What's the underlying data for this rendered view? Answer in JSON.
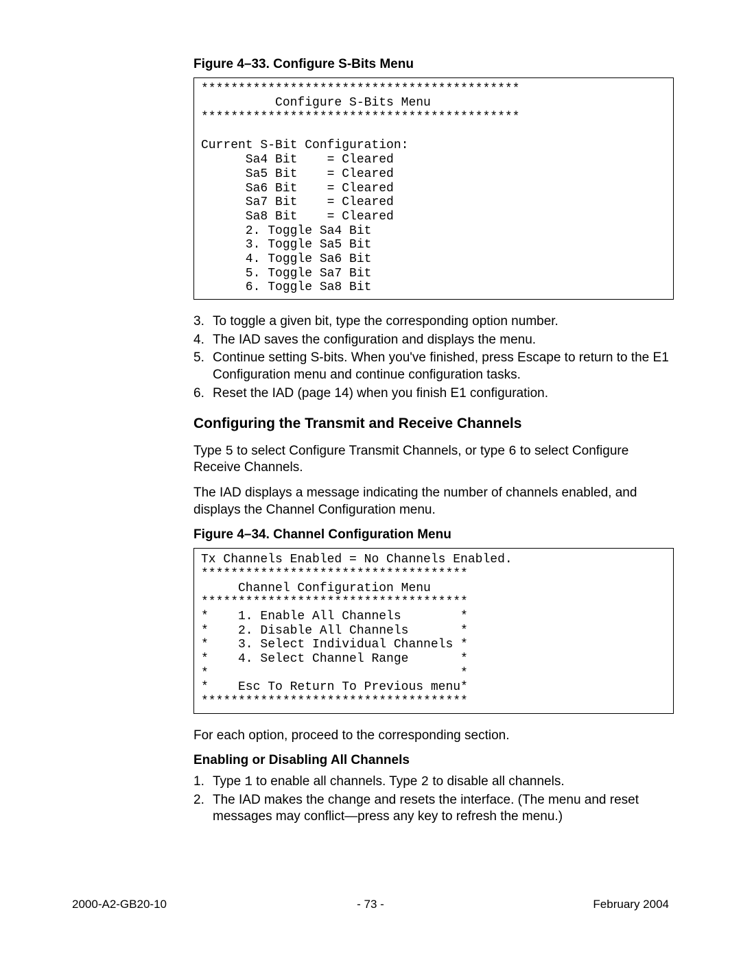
{
  "figure33": {
    "caption": "Figure 4–33.  Configure S-Bits Menu",
    "code": "*******************************************\n          Configure S-Bits Menu\n*******************************************\n\nCurrent S-Bit Configuration:\n      Sa4 Bit    = Cleared\n      Sa5 Bit    = Cleared\n      Sa6 Bit    = Cleared\n      Sa7 Bit    = Cleared\n      Sa8 Bit    = Cleared\n      2. Toggle Sa4 Bit\n      3. Toggle Sa5 Bit\n      4. Toggle Sa6 Bit\n      5. Toggle Sa7 Bit\n      6. Toggle Sa8 Bit"
  },
  "steps_a": [
    {
      "n": "3.",
      "t": "To toggle a given bit, type the corresponding option number."
    },
    {
      "n": "4.",
      "t": "The IAD saves the configuration and displays the menu."
    },
    {
      "n": "5.",
      "t": "Continue setting S-bits. When you've finished, press Escape to return to the E1 Configuration menu and continue configuration tasks."
    },
    {
      "n": "6.",
      "t": "Reset the IAD (page 14) when you finish E1 configuration."
    }
  ],
  "section_head": "Configuring the Transmit and Receive Channels",
  "para1_parts": {
    "a": "Type ",
    "b": "5",
    "c": " to select Configure Transmit Channels, or type ",
    "d": "6",
    "e": "  to select Configure Receive Channels."
  },
  "para2": "The IAD displays a message indicating the number of channels enabled, and displays the Channel Configuration menu.",
  "figure34": {
    "caption": "Figure 4–34.  Channel Configuration Menu",
    "code": "Tx Channels Enabled = No Channels Enabled.\n************************************\n     Channel Configuration Menu\n************************************\n*    1. Enable All Channels        *\n*    2. Disable All Channels       *\n*    3. Select Individual Channels *\n*    4. Select Channel Range       *\n*                                  *\n*    Esc To Return To Previous menu*\n************************************"
  },
  "para3": "For each option, proceed to the corresponding section.",
  "sub_head": "Enabling or Disabling All Channels",
  "steps_b": [
    {
      "n": "1.",
      "pre": "Type ",
      "m1": "1",
      "mid": " to enable all channels. Type ",
      "m2": "2",
      "post": " to disable all channels."
    },
    {
      "n": "2.",
      "t": "The IAD makes the change and resets the interface. (The menu and reset messages may conflict—press any key to refresh the menu.)"
    }
  ],
  "footer": {
    "left": "2000-A2-GB20-10",
    "center": "- 73 -",
    "right": "February 2004"
  }
}
